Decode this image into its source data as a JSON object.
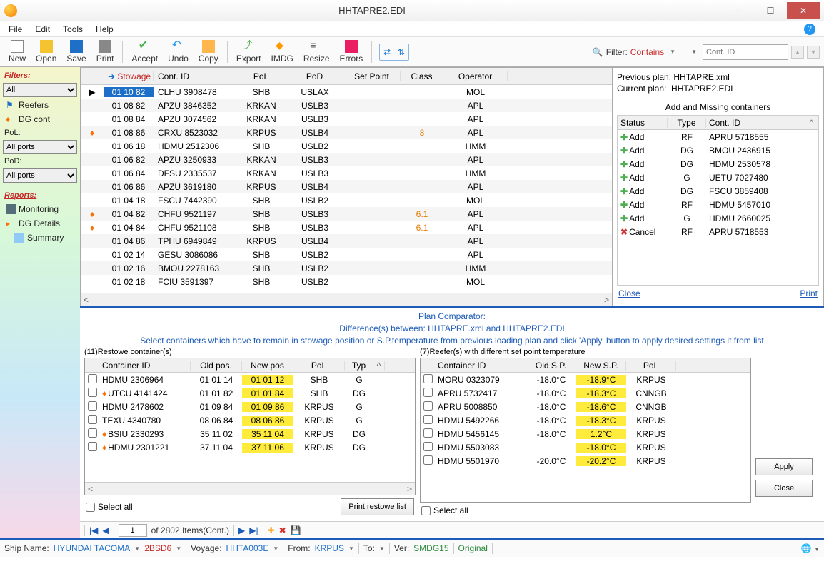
{
  "title": "HHTAPRE2.EDI",
  "menu": {
    "file": "File",
    "edit": "Edit",
    "tools": "Tools",
    "help": "Help"
  },
  "toolbar": {
    "new": "New",
    "open": "Open",
    "save": "Save",
    "print": "Print",
    "accept": "Accept",
    "undo": "Undo",
    "copy": "Copy",
    "export": "Export",
    "imdg": "IMDG",
    "resize": "Resize",
    "errors": "Errors"
  },
  "filter": {
    "label": "Filter:",
    "mode": "Contains",
    "placeholder": "Cont. ID"
  },
  "sidebar": {
    "filters_hdr": "Filters:",
    "all": "All",
    "reefers": "Reefers",
    "dg": "DG cont",
    "pol_lbl": "PoL:",
    "pol_val": "All ports",
    "pod_lbl": "PoD:",
    "pod_val": "All ports",
    "reports_hdr": "Reports:",
    "monitoring": "Monitoring",
    "dg_details": "DG Details",
    "summary": "Summary"
  },
  "grid": {
    "hdr": {
      "stowage": "Stowage",
      "id": "Cont. ID",
      "pol": "PoL",
      "pod": "PoD",
      "sp": "Set Point",
      "cls": "Class",
      "op": "Operator"
    },
    "rows": [
      {
        "flame": false,
        "sel": true,
        "stw": "01 10 82",
        "id": "CLHU 3908478",
        "pol": "SHB",
        "pod": "USLAX",
        "sp": "",
        "cls": "",
        "op": "MOL"
      },
      {
        "flame": false,
        "sel": false,
        "stw": "01 08 82",
        "id": "APZU 3846352",
        "pol": "KRKAN",
        "pod": "USLB3",
        "sp": "",
        "cls": "",
        "op": "APL"
      },
      {
        "flame": false,
        "sel": false,
        "stw": "01 08 84",
        "id": "APZU 3074562",
        "pol": "KRKAN",
        "pod": "USLB3",
        "sp": "",
        "cls": "",
        "op": "APL"
      },
      {
        "flame": true,
        "sel": false,
        "stw": "01 08 86",
        "id": "CRXU 8523032",
        "pol": "KRPUS",
        "pod": "USLB4",
        "sp": "",
        "cls": "8",
        "op": "APL"
      },
      {
        "flame": false,
        "sel": false,
        "stw": "01 06 18",
        "id": "HDMU 2512306",
        "pol": "SHB",
        "pod": "USLB2",
        "sp": "",
        "cls": "",
        "op": "HMM"
      },
      {
        "flame": false,
        "sel": false,
        "stw": "01 06 82",
        "id": "APZU 3250933",
        "pol": "KRKAN",
        "pod": "USLB3",
        "sp": "",
        "cls": "",
        "op": "APL"
      },
      {
        "flame": false,
        "sel": false,
        "stw": "01 06 84",
        "id": "DFSU 2335537",
        "pol": "KRKAN",
        "pod": "USLB3",
        "sp": "",
        "cls": "",
        "op": "HMM"
      },
      {
        "flame": false,
        "sel": false,
        "stw": "01 06 86",
        "id": "APZU 3619180",
        "pol": "KRPUS",
        "pod": "USLB4",
        "sp": "",
        "cls": "",
        "op": "APL"
      },
      {
        "flame": false,
        "sel": false,
        "stw": "01 04 18",
        "id": "FSCU 7442390",
        "pol": "SHB",
        "pod": "USLB2",
        "sp": "",
        "cls": "",
        "op": "MOL"
      },
      {
        "flame": true,
        "sel": false,
        "stw": "01 04 82",
        "id": "CHFU 9521197",
        "pol": "SHB",
        "pod": "USLB3",
        "sp": "",
        "cls": "6.1",
        "op": "APL"
      },
      {
        "flame": true,
        "sel": false,
        "stw": "01 04 84",
        "id": "CHFU 9521108",
        "pol": "SHB",
        "pod": "USLB3",
        "sp": "",
        "cls": "6.1",
        "op": "APL"
      },
      {
        "flame": false,
        "sel": false,
        "stw": "01 04 86",
        "id": "TPHU 6949849",
        "pol": "KRPUS",
        "pod": "USLB4",
        "sp": "",
        "cls": "",
        "op": "APL"
      },
      {
        "flame": false,
        "sel": false,
        "stw": "01 02 14",
        "id": "GESU 3086086",
        "pol": "SHB",
        "pod": "USLB2",
        "sp": "",
        "cls": "",
        "op": "APL"
      },
      {
        "flame": false,
        "sel": false,
        "stw": "01 02 16",
        "id": "BMOU 2278163",
        "pol": "SHB",
        "pod": "USLB2",
        "sp": "",
        "cls": "",
        "op": "HMM"
      },
      {
        "flame": false,
        "sel": false,
        "stw": "01 02 18",
        "id": "FCIU 3591397",
        "pol": "SHB",
        "pod": "USLB2",
        "sp": "",
        "cls": "",
        "op": "MOL"
      }
    ]
  },
  "rightpanel": {
    "prev_lbl": "Previous plan:",
    "prev_val": "HHTAPRE.xml",
    "curr_lbl": "Current plan:",
    "curr_val": "HHTAPRE2.EDI",
    "sub": "Add and Missing containers",
    "hdr": {
      "status": "Status",
      "type": "Type",
      "id": "Cont. ID"
    },
    "rows": [
      {
        "act": "add",
        "status": "Add",
        "type": "RF",
        "id": "APRU 5718555"
      },
      {
        "act": "add",
        "status": "Add",
        "type": "DG",
        "id": "BMOU 2436915"
      },
      {
        "act": "add",
        "status": "Add",
        "type": "DG",
        "id": "HDMU 2530578"
      },
      {
        "act": "add",
        "status": "Add",
        "type": "G",
        "id": "UETU 7027480"
      },
      {
        "act": "add",
        "status": "Add",
        "type": "DG",
        "id": "FSCU 3859408"
      },
      {
        "act": "add",
        "status": "Add",
        "type": "RF",
        "id": "HDMU 5457010"
      },
      {
        "act": "add",
        "status": "Add",
        "type": "G",
        "id": "HDMU 2660025"
      },
      {
        "act": "cancel",
        "status": "Cancel",
        "type": "RF",
        "id": "APRU 5718553"
      }
    ],
    "close": "Close",
    "print": "Print"
  },
  "comparator": {
    "title1": "Plan Comparator:",
    "title2": "Difference(s) between: HHTAPRE.xml and HHTAPRE2.EDI",
    "title3": "Select containers which have to remain in stowage position or S.P.temperature from previous loading plan and click 'Apply' button to apply desired settings it from list",
    "left": {
      "title": "(11)Restowe container(s)",
      "hdr": {
        "id": "Container ID",
        "old": "Old pos.",
        "new": "New pos",
        "pol": "PoL",
        "typ": "Typ"
      },
      "rows": [
        {
          "flame": false,
          "id": "HDMU 2306964",
          "old": "01 01 14",
          "new": "01 01 12",
          "pol": "SHB",
          "typ": "G"
        },
        {
          "flame": true,
          "id": "UTCU 4141424",
          "old": "01 01 82",
          "new": "01 01 84",
          "pol": "SHB",
          "typ": "DG"
        },
        {
          "flame": false,
          "id": "HDMU 2478602",
          "old": "01 09 84",
          "new": "01 09 86",
          "pol": "KRPUS",
          "typ": "G"
        },
        {
          "flame": false,
          "id": "TEXU 4340780",
          "old": "08 06 84",
          "new": "08 06 86",
          "pol": "KRPUS",
          "typ": "G"
        },
        {
          "flame": true,
          "id": "BSIU 2330293",
          "old": "35 11 02",
          "new": "35 11 04",
          "pol": "KRPUS",
          "typ": "DG"
        },
        {
          "flame": true,
          "id": "HDMU 2301221",
          "old": "37 11 04",
          "new": "37 11 06",
          "pol": "KRPUS",
          "typ": "DG"
        }
      ],
      "selectall": "Select all",
      "printbtn": "Print restowe list"
    },
    "right": {
      "title": "(7)Reefer(s) with different  set point temperature",
      "hdr": {
        "id": "Container ID",
        "old": "Old S.P.",
        "new": "New S.P.",
        "pol": "PoL"
      },
      "rows": [
        {
          "id": "MORU 0323079",
          "old": "-18.0°C",
          "new": "-18.9°C",
          "pol": "KRPUS"
        },
        {
          "id": "APRU 5732417",
          "old": "-18.0°C",
          "new": "-18.3°C",
          "pol": "CNNGB"
        },
        {
          "id": "APRU 5008850",
          "old": "-18.0°C",
          "new": "-18.6°C",
          "pol": "CNNGB"
        },
        {
          "id": "HDMU 5492266",
          "old": "-18.0°C",
          "new": "-18.3°C",
          "pol": "KRPUS"
        },
        {
          "id": "HDMU 5456145",
          "old": "-18.0°C",
          "new": "1.2°C",
          "pol": "KRPUS"
        },
        {
          "id": "HDMU 5503083",
          "old": "",
          "new": "-18.0°C",
          "pol": "KRPUS"
        },
        {
          "id": "HDMU 5501970",
          "old": "-20.0°C",
          "new": "-20.2°C",
          "pol": "KRPUS"
        }
      ],
      "selectall": "Select all"
    },
    "apply": "Apply",
    "close": "Close"
  },
  "pager": {
    "page": "1",
    "of": "of 2802 Items(Cont.)"
  },
  "status": {
    "ship_lbl": "Ship Name:",
    "ship": "HYUNDAI TACOMA",
    "code": "2BSD6",
    "voyage_lbl": "Voyage:",
    "voyage": "HHTA003E",
    "from_lbl": "From:",
    "from": "KRPUS",
    "to_lbl": "To:",
    "ver_lbl": "Ver:",
    "ver": "SMDG15",
    "orig": "Original"
  }
}
